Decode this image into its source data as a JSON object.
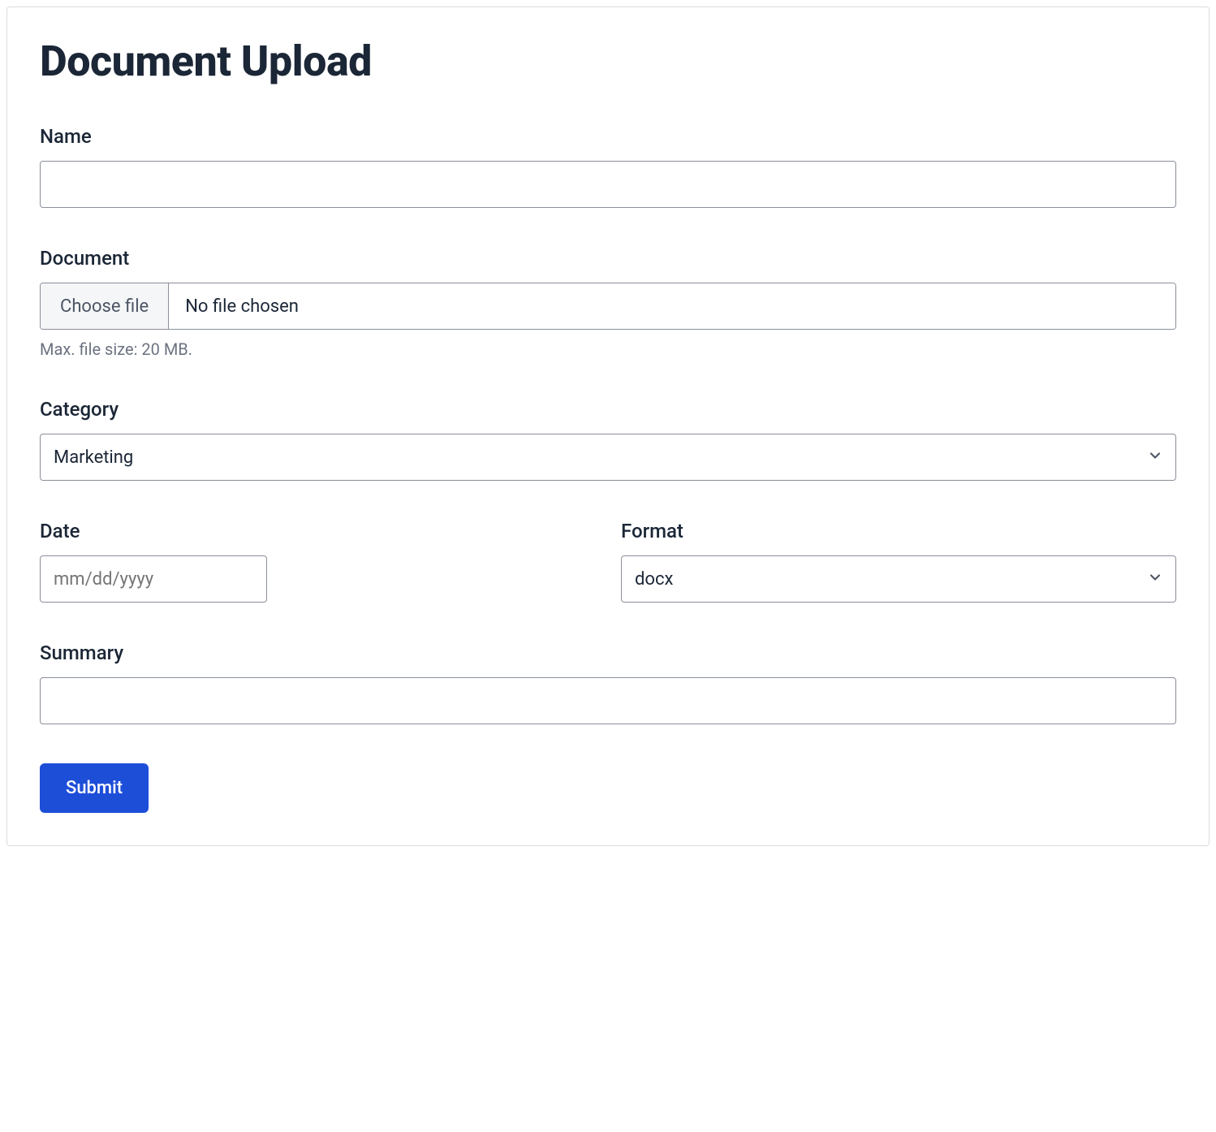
{
  "title": "Document Upload",
  "fields": {
    "name": {
      "label": "Name",
      "value": ""
    },
    "document": {
      "label": "Document",
      "button_label": "Choose file",
      "status": "No file chosen",
      "helper": "Max. file size: 20 MB."
    },
    "category": {
      "label": "Category",
      "selected": "Marketing"
    },
    "date": {
      "label": "Date",
      "placeholder": "mm/dd/yyyy",
      "value": ""
    },
    "format": {
      "label": "Format",
      "selected": "docx"
    },
    "summary": {
      "label": "Summary",
      "value": ""
    }
  },
  "submit_label": "Submit"
}
